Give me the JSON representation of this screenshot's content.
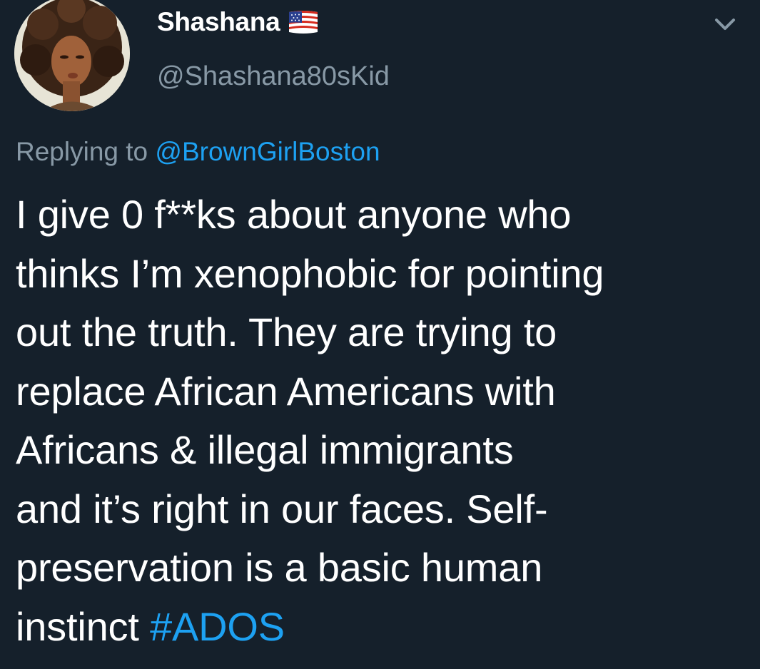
{
  "user": {
    "display_name": "Shashana",
    "handle": "@Shashana80sKid",
    "flag_icon": "us-flag-icon"
  },
  "reply": {
    "prefix": "Replying to",
    "mention": "@BrownGirlBoston"
  },
  "tweet": {
    "lines": [
      "I give 0 f**ks about anyone who",
      "thinks I’m xenophobic for pointing",
      "out the truth. They are trying to",
      "replace African Americans with",
      "Africans & illegal immigrants",
      "and it’s right in our faces. Self-",
      "preservation is a basic human",
      "instinct "
    ],
    "hashtag": "#ADOS"
  },
  "menu": {
    "icon": "chevron-down-icon"
  },
  "colors": {
    "background": "#15202b",
    "primary_text": "#ffffff",
    "secondary_text": "#8899a6",
    "accent": "#1da1f2"
  }
}
